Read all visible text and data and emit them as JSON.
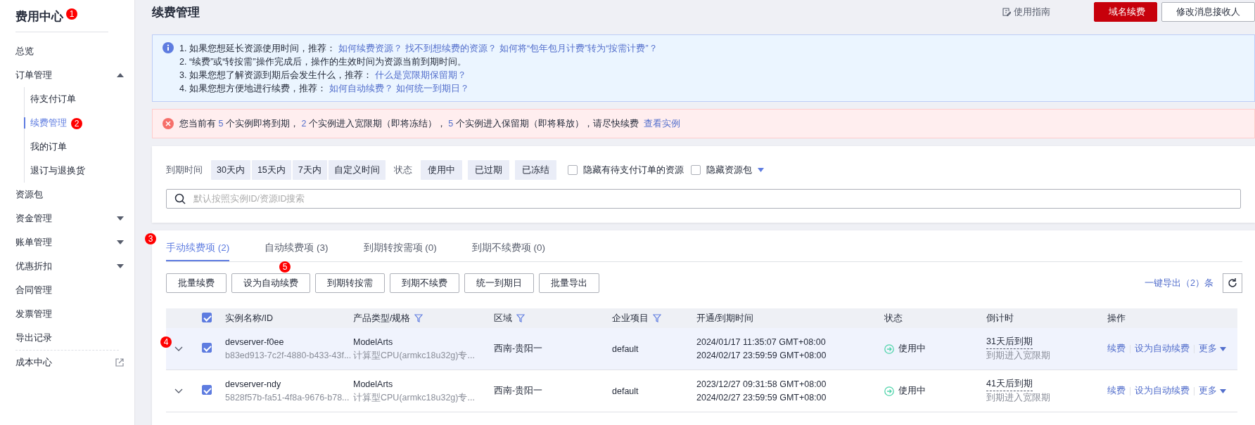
{
  "sidebar": {
    "title": "费用中心",
    "title_marker": "1",
    "items": [
      {
        "label": "总览",
        "kind": "link",
        "selected": false
      },
      {
        "label": "订单管理",
        "kind": "group",
        "expanded": true,
        "selected": false,
        "children": [
          {
            "label": "待支付订单",
            "selected": false
          },
          {
            "label": "续费管理",
            "selected": true,
            "marker": "2"
          },
          {
            "label": "我的订单",
            "selected": false
          },
          {
            "label": "退订与退换货",
            "selected": false
          }
        ]
      },
      {
        "label": "资源包",
        "kind": "link",
        "selected": false
      },
      {
        "label": "资金管理",
        "kind": "group",
        "expanded": false,
        "selected": false
      },
      {
        "label": "账单管理",
        "kind": "group",
        "expanded": false,
        "selected": false
      },
      {
        "label": "优惠折扣",
        "kind": "group",
        "expanded": false,
        "selected": false
      },
      {
        "label": "合同管理",
        "kind": "link",
        "selected": false
      },
      {
        "label": "发票管理",
        "kind": "link",
        "selected": false
      },
      {
        "label": "导出记录",
        "kind": "link",
        "selected": false
      },
      {
        "label": "成本中心",
        "kind": "external",
        "selected": false
      }
    ]
  },
  "header": {
    "title": "续费管理",
    "guide_link": "使用指南",
    "buttons": [
      {
        "label": "域名续费",
        "kind": "primary"
      },
      {
        "label": "修改消息接收人",
        "kind": "default"
      }
    ]
  },
  "info": {
    "lines": [
      {
        "text": "1. 如果您想延长资源使用时间，推荐：",
        "links": [
          "如何续费资源？",
          "找不到想续费的资源？",
          "如何将“包年包月计费”转为“按需计费”？"
        ]
      },
      {
        "text": "2. “续费”或“转按需”操作完成后，操作的生效时间为资源当前到期时间。"
      },
      {
        "text": "3. 如果您想了解资源到期后会发生什么，推荐：",
        "links": [
          "什么是宽限期保留期？"
        ]
      },
      {
        "text": "4. 如果您想方便地进行续费，推荐：",
        "links": [
          "如何自动续费？",
          "如何统一到期日？"
        ]
      }
    ]
  },
  "alert": {
    "parts": [
      {
        "kind": "plain",
        "text": "您当前有 "
      },
      {
        "kind": "count",
        "text": "5"
      },
      {
        "kind": "plain",
        "text": " 个实例即将到期， "
      },
      {
        "kind": "count",
        "text": "2"
      },
      {
        "kind": "plain",
        "text": " 个实例进入宽限期（即将冻结）， "
      },
      {
        "kind": "count",
        "text": "5"
      },
      {
        "kind": "plain",
        "text": " 个实例进入保留期（即将释放），请尽快续费 "
      },
      {
        "kind": "link",
        "text": "查看实例"
      }
    ]
  },
  "filters": {
    "expiry_label": "到期时间",
    "expiry_options": [
      {
        "label": "30天内",
        "selected": false
      },
      {
        "label": "15天内",
        "selected": false
      },
      {
        "label": "7天内",
        "selected": false
      },
      {
        "label": "自定义时间",
        "selected": false
      }
    ],
    "status_label": "状态",
    "status_options": [
      {
        "label": "使用中",
        "selected": false
      },
      {
        "label": "已过期",
        "selected": false
      },
      {
        "label": "已冻结",
        "selected": false
      }
    ],
    "checkboxes": [
      {
        "label": "隐藏有待支付订单的资源",
        "checked": false,
        "dropdown": false
      },
      {
        "label": "隐藏资源包",
        "checked": false,
        "dropdown": true
      }
    ],
    "search": {
      "placeholder": "默认按照实例ID/资源ID搜索"
    }
  },
  "tabs_marker": "3",
  "tabs": [
    {
      "label": "手动续费项 (2)",
      "selected": true
    },
    {
      "label": "自动续费项 (3)",
      "selected": false
    },
    {
      "label": "到期转按需项 (0)",
      "selected": false
    },
    {
      "label": "到期不续费项 (0)",
      "selected": false
    }
  ],
  "toolbar": {
    "buttons": [
      {
        "label": "批量续费"
      },
      {
        "label": "设为自动续费",
        "marker": "5"
      },
      {
        "label": "到期转按需"
      },
      {
        "label": "到期不续费"
      },
      {
        "label": "统一到期日"
      },
      {
        "label": "批量导出"
      }
    ],
    "export_link": "一键导出（2）条"
  },
  "table": {
    "select_all": true,
    "columns": [
      {
        "label": "实例名称/ID",
        "filter": false
      },
      {
        "label": "产品类型/规格",
        "filter": true
      },
      {
        "label": "区域",
        "filter": true
      },
      {
        "label": "企业项目",
        "filter": true
      },
      {
        "label": "开通/到期时间",
        "filter": false
      },
      {
        "label": "状态",
        "filter": false
      },
      {
        "label": "倒计时",
        "filter": false
      },
      {
        "label": "操作",
        "filter": false
      }
    ],
    "rows": [
      {
        "marker": "4",
        "expanded": false,
        "checked": true,
        "highlighted": true,
        "name": "devserver-f0ee",
        "id": "b83ed913-7c2f-4880-b433-43f...",
        "product": "ModelArts",
        "spec": "计算型CPU(armkc18u32g)专...",
        "region": "西南-贵阳一",
        "project": "default",
        "start": "2024/01/17 11:35:07 GMT+08:00",
        "end": "2024/02/17 23:59:59 GMT+08:00",
        "status": "使用中",
        "countdown": "31天后到期",
        "countdown_note": "到期进入宽限期",
        "actions": [
          "续费",
          "设为自动续费",
          "更多"
        ]
      },
      {
        "expanded": false,
        "checked": true,
        "highlighted": false,
        "name": "devserver-ndy",
        "id": "5828f57b-fa51-4f8a-9676-b78...",
        "product": "ModelArts",
        "spec": "计算型CPU(armkc18u32g)专...",
        "region": "西南-贵阳一",
        "project": "default",
        "start": "2023/12/27 09:31:58 GMT+08:00",
        "end": "2024/02/27 23:59:59 GMT+08:00",
        "status": "使用中",
        "countdown": "41天后到期",
        "countdown_note": "到期进入宽限期",
        "actions": [
          "续费",
          "设为自动续费",
          "更多"
        ]
      }
    ]
  }
}
